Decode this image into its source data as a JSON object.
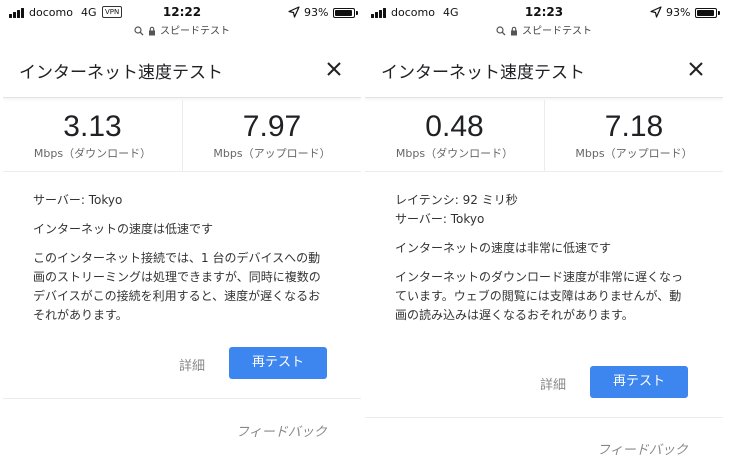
{
  "screens": [
    {
      "status": {
        "carrier": "docomo",
        "network": "4G",
        "vpn": "VPN",
        "time": "12:22",
        "battery": "93%"
      },
      "url": "スピードテスト",
      "title": "インターネット速度テスト",
      "download": {
        "value": "3.13",
        "unit": "Mbps（ダウンロード）"
      },
      "upload": {
        "value": "7.97",
        "unit": "Mbps（アップロード）"
      },
      "server": "サーバー: Tokyo",
      "summary": "インターネットの速度は低速です",
      "description": "このインターネット接続では、1 台のデバイスへの動画のストリーミングは処理できますが、同時に複数のデバイスがこの接続を利用すると、速度が遅くなるおそれがあります。",
      "details_label": "詳細",
      "retest_label": "再テスト",
      "feedback_label": "フィードバック"
    },
    {
      "status": {
        "carrier": "docomo",
        "network": "4G",
        "time": "12:23",
        "battery": "93%"
      },
      "url": "スピードテスト",
      "title": "インターネット速度テスト",
      "download": {
        "value": "0.48",
        "unit": "Mbps（ダウンロード）"
      },
      "upload": {
        "value": "7.18",
        "unit": "Mbps（アップロード）"
      },
      "latency": "レイテンシ: 92 ミリ秒",
      "server": "サーバー: Tokyo",
      "summary": "インターネットの速度は非常に低速です",
      "description": "インターネットのダウンロード速度が非常に遅くなっています。ウェブの閲覧には支障はありませんが、動画の読み込みは遅くなるおそれがあります。",
      "details_label": "詳細",
      "retest_label": "再テスト",
      "feedback_label": "フィードバック"
    }
  ],
  "colors": {
    "accent": "#3d86ef",
    "muted": "#888888",
    "divider": "#ececec"
  }
}
